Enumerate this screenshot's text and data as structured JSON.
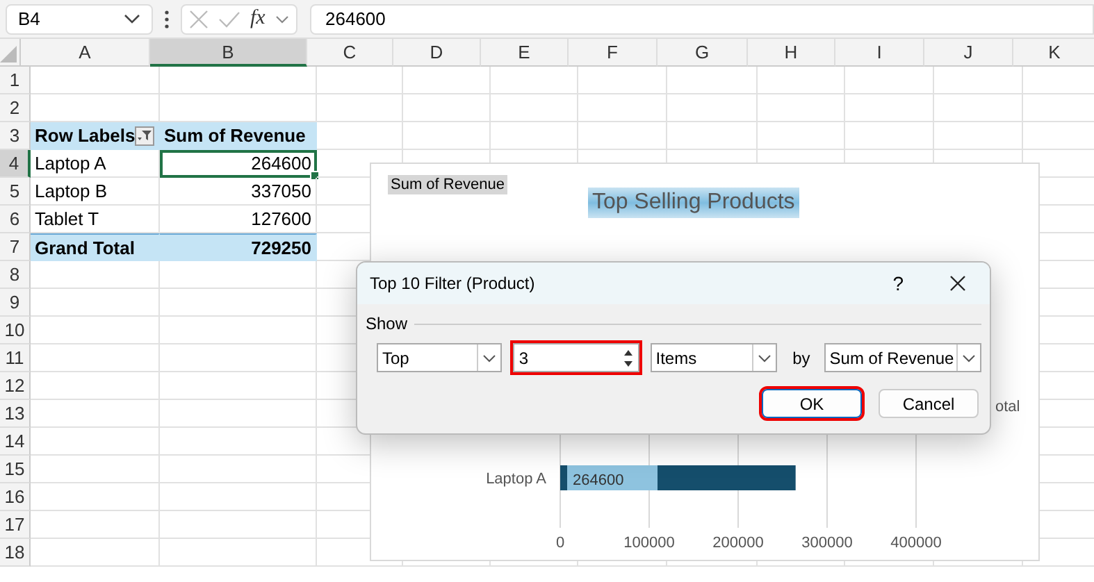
{
  "formula_bar": {
    "name_box": "B4",
    "fx": "fx",
    "value": "264600"
  },
  "sheet": {
    "columns": [
      {
        "label": "A",
        "selected": false
      },
      {
        "label": "B",
        "selected": true
      },
      {
        "label": "C",
        "selected": false
      },
      {
        "label": "D",
        "selected": false
      },
      {
        "label": "E",
        "selected": false
      },
      {
        "label": "F",
        "selected": false
      },
      {
        "label": "G",
        "selected": false
      },
      {
        "label": "H",
        "selected": false
      },
      {
        "label": "I",
        "selected": false
      },
      {
        "label": "J",
        "selected": false
      },
      {
        "label": "K",
        "selected": false
      }
    ],
    "rows": [
      {
        "label": "1",
        "selected": false
      },
      {
        "label": "2",
        "selected": false
      },
      {
        "label": "3",
        "selected": false,
        "cells": [
          {
            "kind": "header",
            "text": "Row Labels",
            "filter": true,
            "selected": false
          },
          {
            "kind": "header",
            "text": "Sum of Revenue",
            "filter": false,
            "selected": false
          }
        ]
      },
      {
        "label": "4",
        "selected": true,
        "cells": [
          {
            "kind": "label",
            "text": "Laptop A",
            "selected": false
          },
          {
            "kind": "value",
            "text": "264600",
            "selected": true
          }
        ]
      },
      {
        "label": "5",
        "selected": false,
        "cells": [
          {
            "kind": "label",
            "text": "Laptop B",
            "selected": false
          },
          {
            "kind": "value",
            "text": "337050",
            "selected": false
          }
        ]
      },
      {
        "label": "6",
        "selected": false,
        "cells": [
          {
            "kind": "label",
            "text": "Tablet T",
            "selected": false
          },
          {
            "kind": "value",
            "text": "127600",
            "selected": false
          }
        ]
      },
      {
        "label": "7",
        "selected": false,
        "cells": [
          {
            "kind": "total",
            "text": "Grand Total",
            "selected": false
          },
          {
            "kind": "total-value",
            "text": "729250",
            "selected": false
          }
        ]
      },
      {
        "label": "8",
        "selected": false
      },
      {
        "label": "9",
        "selected": false
      },
      {
        "label": "10",
        "selected": false
      },
      {
        "label": "11",
        "selected": false
      },
      {
        "label": "12",
        "selected": false
      },
      {
        "label": "13",
        "selected": false
      },
      {
        "label": "14",
        "selected": false
      },
      {
        "label": "15",
        "selected": false
      },
      {
        "label": "16",
        "selected": false
      },
      {
        "label": "17",
        "selected": false
      },
      {
        "label": "18",
        "selected": false
      }
    ]
  },
  "chart": {
    "field_button": "Sum of Revenue",
    "title": "Top Selling Products",
    "legend": "otal",
    "chart_data": {
      "type": "bar",
      "orientation": "horizontal",
      "categories": [
        "Laptop A"
      ],
      "values": [
        264600
      ],
      "grid": true,
      "xlim": [
        0,
        400000
      ],
      "xticks": [
        0,
        100000,
        200000,
        300000,
        400000
      ],
      "data_labels": true
    }
  },
  "dialog": {
    "title": "Top 10 Filter (Product)",
    "help": "?",
    "group": "Show",
    "show": "Top",
    "count": {
      "value": "3",
      "highlighted": true
    },
    "unit": "Items",
    "by": "by",
    "field": "Sum of Revenue",
    "buttons": [
      {
        "label": "OK",
        "default": true,
        "highlighted": true
      },
      {
        "label": "Cancel",
        "default": false,
        "highlighted": false
      }
    ]
  }
}
